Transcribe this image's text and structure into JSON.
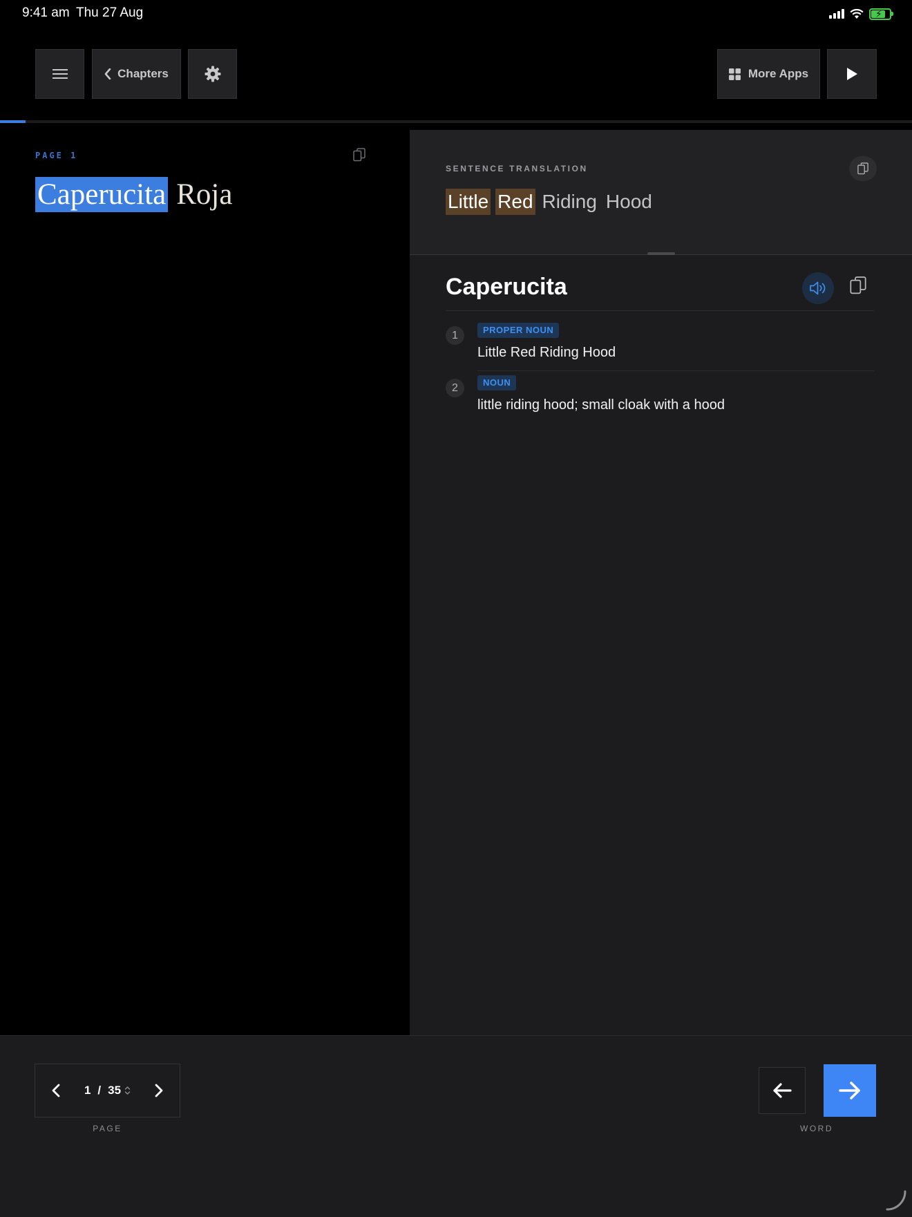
{
  "status_bar": {
    "time": "9:41 am",
    "date": "Thu 27 Aug"
  },
  "toolbar": {
    "chapters_label": "Chapters",
    "more_apps_label": "More Apps"
  },
  "reader": {
    "page_label": "PAGE 1",
    "sentence_words": [
      "Caperucita",
      "Roja"
    ],
    "highlighted_word_index": 0
  },
  "translation": {
    "section_label": "SENTENCE TRANSLATION",
    "words": [
      "Little",
      "Red",
      "Riding",
      "Hood"
    ],
    "highlighted_indices": [
      0,
      1
    ]
  },
  "dictionary": {
    "headword": "Caperucita",
    "definitions": [
      {
        "number": "1",
        "pos": "PROPER NOUN",
        "gloss": "Little Red Riding Hood"
      },
      {
        "number": "2",
        "pos": "NOUN",
        "gloss": "little riding hood; small cloak with a hood"
      }
    ]
  },
  "footer": {
    "current_page": "1",
    "separator": "/",
    "total_pages": "35",
    "page_caption": "PAGE",
    "word_caption": "WORD"
  },
  "colors": {
    "accent": "#3e86f6",
    "highlight_word": "#3b7ee0",
    "translation_highlight": "#5a4127",
    "pos_badge_text": "#3f8ff0"
  }
}
